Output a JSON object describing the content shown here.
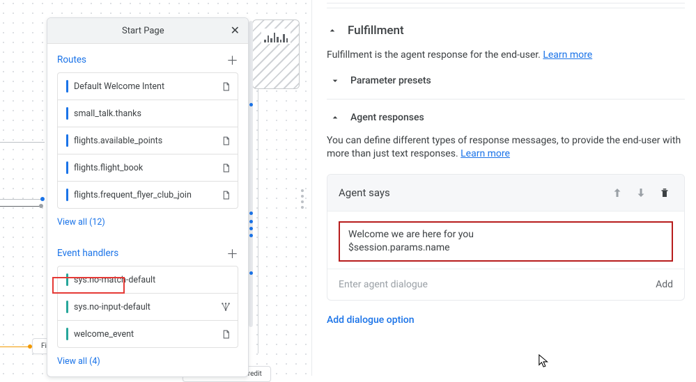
{
  "startPage": {
    "title": "Start Page",
    "routes_label": "Routes",
    "routes": [
      {
        "label": "Default Welcome Intent",
        "rightIcon": "page"
      },
      {
        "label": "small_talk.thanks",
        "rightIcon": ""
      },
      {
        "label": "flights.available_points",
        "rightIcon": "page"
      },
      {
        "label": "flights.flight_book",
        "rightIcon": "page"
      },
      {
        "label": "flights.frequent_flyer_club_join",
        "rightIcon": "page"
      }
    ],
    "routes_viewall": "View all (12)",
    "handlers_label": "Event handlers",
    "handlers": [
      {
        "label": "sys.no-match-default",
        "rightIcon": ""
      },
      {
        "label": "sys.no-input-default",
        "rightIcon": "fan"
      },
      {
        "label": "welcome_event",
        "rightIcon": "page"
      }
    ],
    "handlers_viewall": "View all (4)"
  },
  "canvas_nodes": {
    "find_paid_ticket": "Find Paid Ticket",
    "display_account_credit": "Display Account Credit"
  },
  "panel": {
    "fulfillment": {
      "title": "Fulfillment",
      "description_pre": "Fulfillment is the agent response for the end-user. ",
      "learn_more": "Learn more"
    },
    "parameter_presets_title": "Parameter presets",
    "agent_responses": {
      "title": "Agent responses",
      "description_pre": "You can define different types of response messages, to provide the end-user with more than just text responses. ",
      "learn_more": "Learn more",
      "card_title": "Agent says",
      "redbox_text": "Welcome  we are here for you\n$session.params.name",
      "dialogue_placeholder": "Enter agent dialogue",
      "add_label": "Add",
      "add_dialogue_option": "Add dialogue option"
    }
  }
}
